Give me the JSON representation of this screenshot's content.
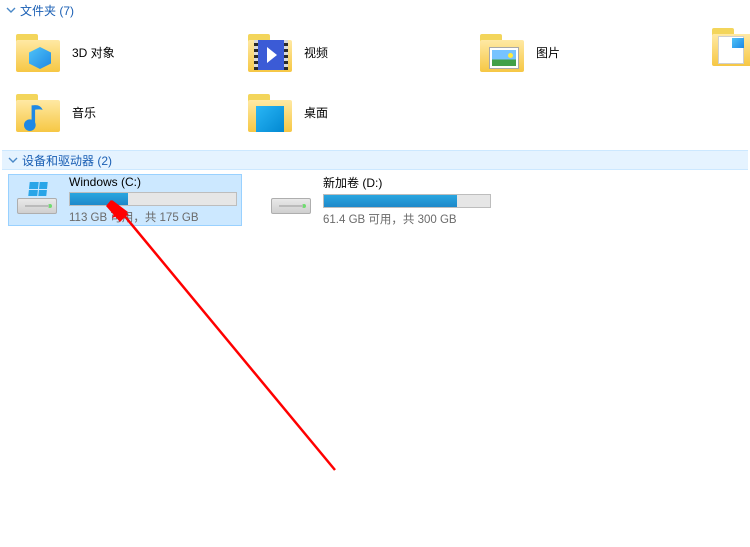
{
  "sections": {
    "folders_header": "文件夹 (7)",
    "drives_header": "设备和驱动器 (2)"
  },
  "folders": [
    {
      "id": "3d",
      "label": "3D 对象"
    },
    {
      "id": "videos",
      "label": "视频"
    },
    {
      "id": "pictures",
      "label": "图片"
    },
    {
      "id": "music",
      "label": "音乐"
    },
    {
      "id": "desktop",
      "label": "桌面"
    }
  ],
  "drives": [
    {
      "id": "c",
      "name": "Windows (C:)",
      "status": "113 GB 可用，共 175 GB",
      "used_percent": 35,
      "selected": true,
      "has_winlogo": true
    },
    {
      "id": "d",
      "name": "新加卷 (D:)",
      "status": "61.4 GB 可用，共 300 GB",
      "used_percent": 80,
      "selected": false,
      "has_winlogo": false
    }
  ]
}
